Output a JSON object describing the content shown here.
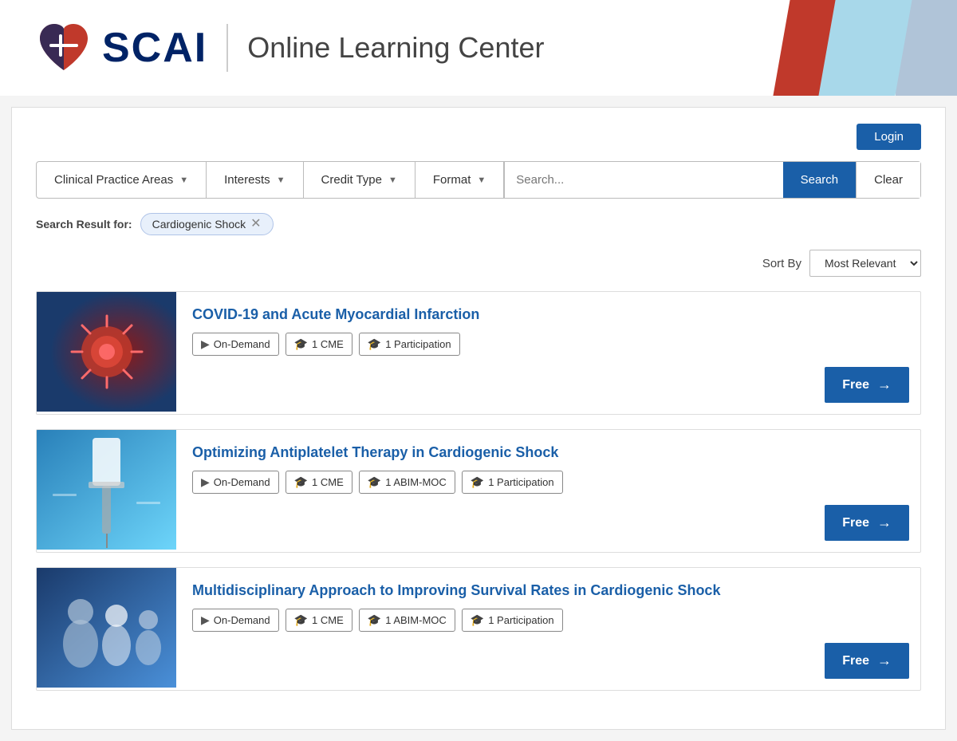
{
  "header": {
    "logo_text": "SCAI",
    "olc_text": "Online Learning Center",
    "login_label": "Login"
  },
  "filterbar": {
    "clinical_label": "Clinical Practice Areas",
    "interests_label": "Interests",
    "credit_type_label": "Credit Type",
    "format_label": "Format",
    "search_placeholder": "Search...",
    "search_btn": "Search",
    "clear_btn": "Clear"
  },
  "search_result": {
    "label": "Search Result for:",
    "tag_text": "Cardiogenic Shock"
  },
  "sort": {
    "label": "Sort By",
    "option": "Most Relevant"
  },
  "courses": [
    {
      "id": "course-1",
      "title": "COVID-19 and Acute Myocardial Infarction",
      "tags": [
        {
          "icon": "▶",
          "label": "On-Demand"
        },
        {
          "icon": "🎓",
          "label": "1 CME"
        },
        {
          "icon": "🎓",
          "label": "1 Participation"
        }
      ],
      "free_label": "Free",
      "thumb_type": "covid"
    },
    {
      "id": "course-2",
      "title": "Optimizing Antiplatelet Therapy in Cardiogenic Shock",
      "tags": [
        {
          "icon": "▶",
          "label": "On-Demand"
        },
        {
          "icon": "🎓",
          "label": "1 CME"
        },
        {
          "icon": "🎓",
          "label": "1 ABIM-MOC"
        },
        {
          "icon": "🎓",
          "label": "1 Participation"
        }
      ],
      "free_label": "Free",
      "thumb_type": "iv"
    },
    {
      "id": "course-3",
      "title": "Multidisciplinary Approach to Improving Survival Rates in Cardiogenic Shock",
      "tags": [
        {
          "icon": "▶",
          "label": "On-Demand"
        },
        {
          "icon": "🎓",
          "label": "1 CME"
        },
        {
          "icon": "🎓",
          "label": "1 ABIM-MOC"
        },
        {
          "icon": "🎓",
          "label": "1 Participation"
        }
      ],
      "free_label": "Free",
      "thumb_type": "team"
    }
  ]
}
